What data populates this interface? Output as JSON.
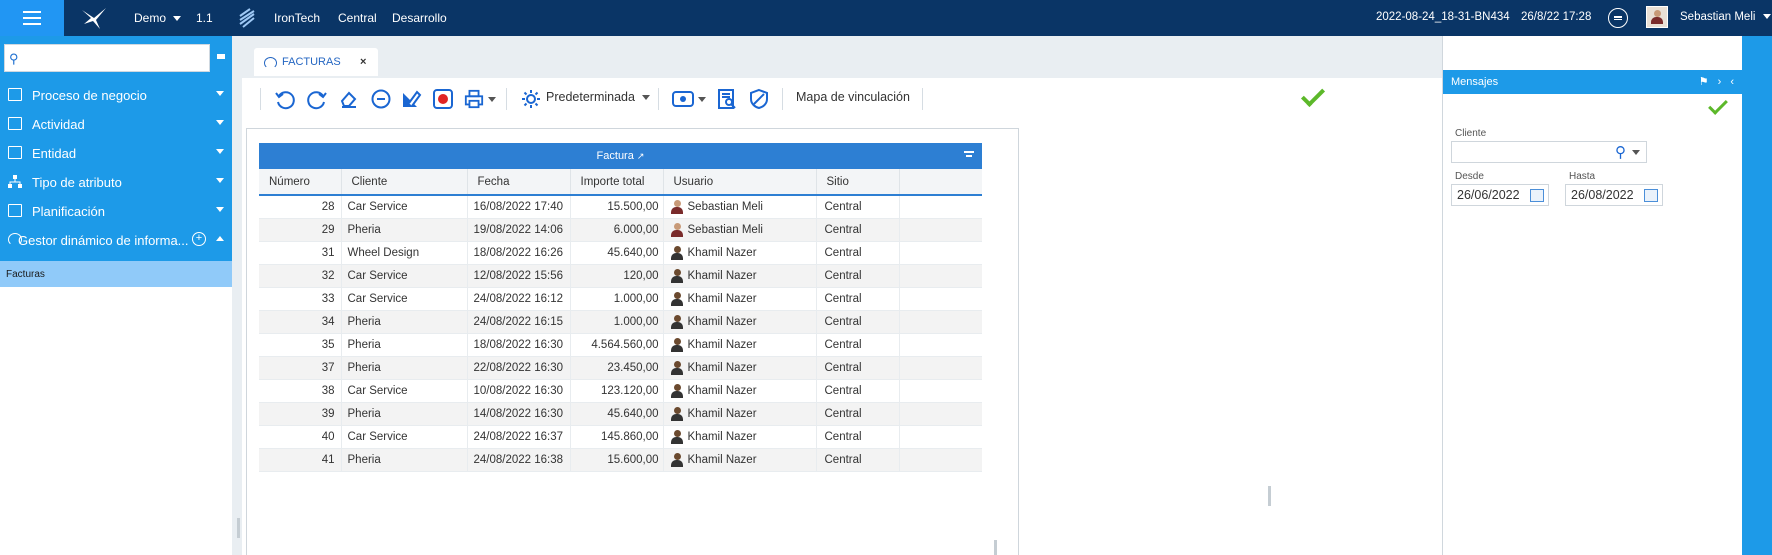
{
  "topbar": {
    "company": "Demo",
    "version": "1.1",
    "org": "IronTech",
    "branch": "Central",
    "env": "Desarrollo",
    "build": "2022-08-24_18-31-BN434",
    "datetime": "26/8/22 17:28",
    "user": "Sebastian Meli"
  },
  "sidebar": {
    "search_placeholder": "",
    "items": [
      {
        "label": "Proceso de negocio"
      },
      {
        "label": "Actividad"
      },
      {
        "label": "Entidad"
      },
      {
        "label": "Tipo de atributo"
      },
      {
        "label": "Planificación"
      },
      {
        "label": "Gestor dinámico de informa..."
      }
    ],
    "sub_item": "Facturas"
  },
  "tab": {
    "label": "FACTURAS",
    "close": "×"
  },
  "toolbar": {
    "view_label": "Predeterminada",
    "link_map_label": "Mapa de vinculación"
  },
  "grid": {
    "title": "Factura",
    "columns": [
      "Número",
      "Cliente",
      "Fecha",
      "Importe total",
      "Usuario",
      "Sitio"
    ],
    "rows": [
      [
        "28",
        "Car Service",
        "16/08/2022 17:40",
        "15.500,00",
        "Sebastian Meli",
        "Central"
      ],
      [
        "29",
        "Pheria",
        "19/08/2022 14:06",
        "6.000,00",
        "Sebastian Meli",
        "Central"
      ],
      [
        "31",
        "Wheel Design",
        "18/08/2022 16:26",
        "45.640,00",
        "Khamil Nazer",
        "Central"
      ],
      [
        "32",
        "Car Service",
        "12/08/2022 15:56",
        "120,00",
        "Khamil Nazer",
        "Central"
      ],
      [
        "33",
        "Car Service",
        "24/08/2022 16:12",
        "1.000,00",
        "Khamil Nazer",
        "Central"
      ],
      [
        "34",
        "Pheria",
        "24/08/2022 16:15",
        "1.000,00",
        "Khamil Nazer",
        "Central"
      ],
      [
        "35",
        "Pheria",
        "18/08/2022 16:30",
        "4.564.560,00",
        "Khamil Nazer",
        "Central"
      ],
      [
        "37",
        "Pheria",
        "22/08/2022 16:30",
        "23.450,00",
        "Khamil Nazer",
        "Central"
      ],
      [
        "38",
        "Car Service",
        "10/08/2022 16:30",
        "123.120,00",
        "Khamil Nazer",
        "Central"
      ],
      [
        "39",
        "Pheria",
        "14/08/2022 16:30",
        "45.640,00",
        "Khamil Nazer",
        "Central"
      ],
      [
        "40",
        "Car Service",
        "24/08/2022 16:37",
        "145.860,00",
        "Khamil Nazer",
        "Central"
      ],
      [
        "41",
        "Pheria",
        "24/08/2022 16:38",
        "15.600,00",
        "Khamil Nazer",
        "Central"
      ]
    ]
  },
  "messages": {
    "title": "Mensajes",
    "cliente_label": "Cliente",
    "cliente_value": "",
    "desde_label": "Desde",
    "desde_value": "26/06/2022",
    "hasta_label": "Hasta",
    "hasta_value": "26/08/2022"
  },
  "colors": {
    "topbar": "#0a3566",
    "accent": "#1d9ae8",
    "header": "#2d7fd3",
    "ok": "#5cb82a"
  }
}
